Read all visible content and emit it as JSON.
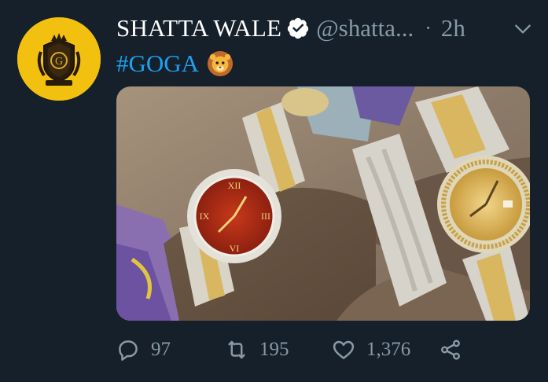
{
  "tweet": {
    "author": {
      "display_name": "SHATTA WALE",
      "handle": "@shatta...",
      "verified_icon": "verified-badge-icon"
    },
    "separator": "·",
    "timestamp": "2h",
    "text": {
      "hashtag": "#GOGA",
      "emoji": "lion-face-emoji"
    },
    "media": {
      "description_icon": "photo"
    },
    "actions": {
      "reply_count": "97",
      "retweet_count": "195",
      "like_count": "1,376"
    }
  },
  "colors": {
    "background": "#15202b",
    "name": "#ffffff",
    "secondary": "#8899a6",
    "link": "#1da1f2",
    "avatar_bg": "#f2c10f"
  }
}
